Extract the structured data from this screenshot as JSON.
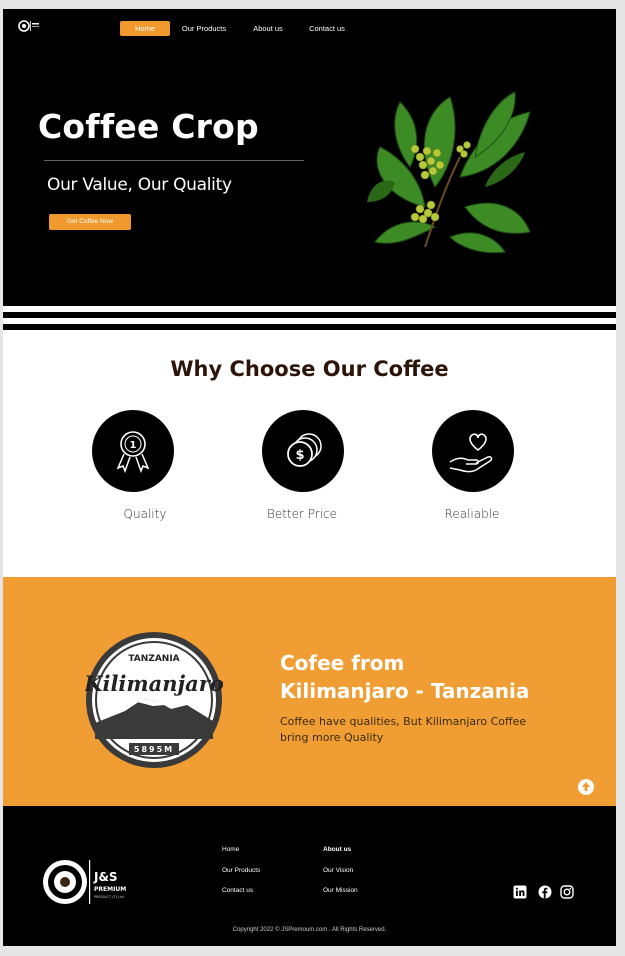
{
  "nav": {
    "items": [
      {
        "label": "Home",
        "active": true
      },
      {
        "label": "Our Products",
        "active": false
      },
      {
        "label": "About us",
        "active": false
      },
      {
        "label": "Contact us",
        "active": false
      }
    ]
  },
  "hero": {
    "title": "Coffee Crop",
    "subtitle": "Our Value, Our Quality",
    "cta_label": "Get Coffee Now",
    "image_icon": "coffee-plant-illustration"
  },
  "why": {
    "title": "Why Choose Our Coffee",
    "features": [
      {
        "label": "Quality",
        "icon": "award-medal-icon"
      },
      {
        "label": "Better Price",
        "icon": "coins-dollar-icon"
      },
      {
        "label": "Realiable",
        "icon": "heart-hand-icon"
      }
    ]
  },
  "origin": {
    "title_line1": "Cofee from",
    "title_line2": "Kilimanjaro - Tanzania",
    "text": "Coffee have qualities, But Kilimanjaro Coffee bring more Quality",
    "badge": {
      "top_text": "TANZANIA",
      "script_text": "Kilimanjaro",
      "elevation": "5895M"
    }
  },
  "footer": {
    "logo_text": "J&S",
    "logo_subtext": "PREMIUM",
    "logo_tagline": "PRODUCT (T) Ltd",
    "col1": [
      "Home",
      "Our Products",
      "Contact us"
    ],
    "col2": [
      "About us",
      "Our Vision",
      "Our Mission"
    ],
    "social": [
      "linkedin-icon",
      "facebook-icon",
      "instagram-icon"
    ],
    "copyright": "Copyright 2022 © JSPremoum.com . All Rights Reserved."
  },
  "colors": {
    "accent": "#f09a2d",
    "orange_bg": "#f09e33",
    "dark": "#000000",
    "heading": "#2c1408"
  }
}
